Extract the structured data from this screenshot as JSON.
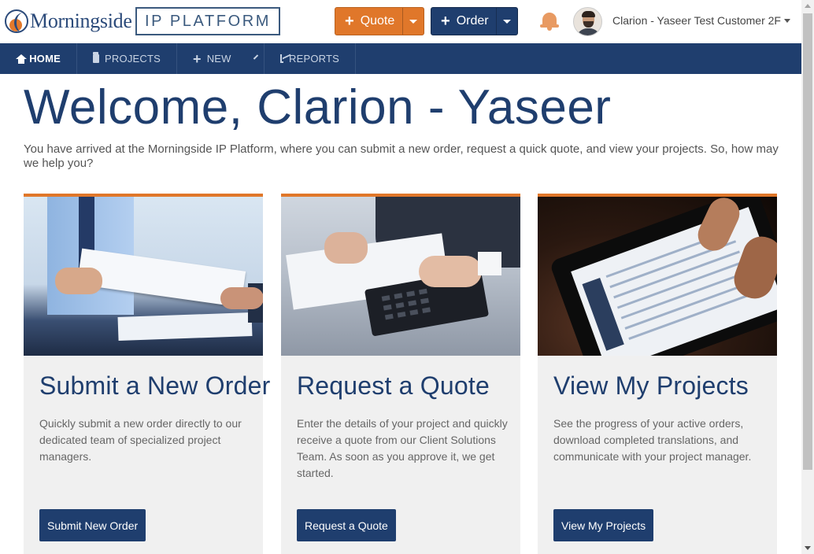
{
  "header": {
    "logo_text": "Morningside",
    "platform_label": "IP PLATFORM",
    "quote_button": "Quote",
    "order_button": "Order",
    "user_name": "Clarion - Yaseer Test Customer 2F"
  },
  "nav": {
    "items": [
      {
        "label": "HOME",
        "icon": "home-icon",
        "active": true
      },
      {
        "label": "PROJECTS",
        "icon": "folder-icon",
        "active": false
      },
      {
        "label": "NEW",
        "icon": "plus-icon",
        "active": false
      },
      {
        "label": "REPORTS",
        "icon": "chart-icon",
        "active": false
      }
    ]
  },
  "main": {
    "welcome": "Welcome, Clarion - Yaseer",
    "intro": "You have arrived at the Morningside IP Platform, where you can submit a new order, request a quick quote, and view your projects. So, how may we help you?",
    "cards": [
      {
        "title": "Submit a New Order",
        "description": "Quickly submit a new order directly to our dedicated team of specialized project managers.",
        "button": "Submit New Order"
      },
      {
        "title": "Request a Quote",
        "description": "Enter the details of your project and quickly receive a quote from our Client Solutions Team. As soon as you approve it, we get started.",
        "button": "Request a Quote"
      },
      {
        "title": "View My Projects",
        "description": "See the progress of your active orders, download completed translations, and communicate with your project manager.",
        "button": "View My Projects"
      }
    ]
  },
  "colors": {
    "primary": "#1f3e6e",
    "accent": "#e0772a",
    "card_bg": "#f0f0f0"
  }
}
